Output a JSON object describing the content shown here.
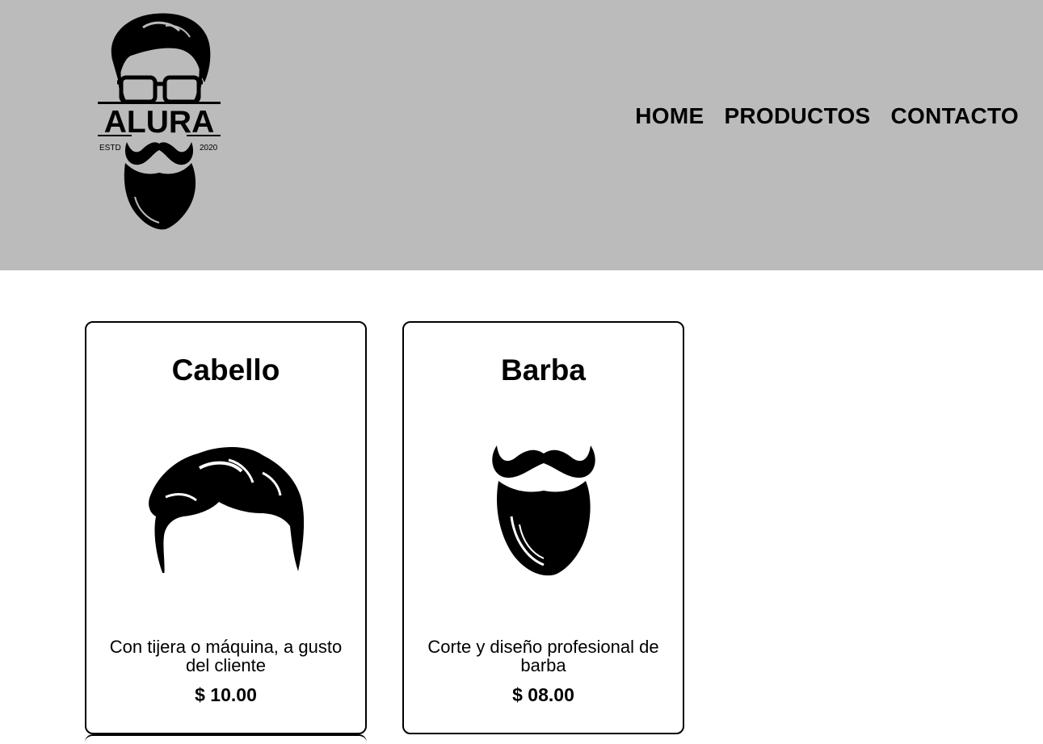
{
  "header": {
    "logo": {
      "brand": "ALURA",
      "est_left": "ESTD",
      "est_right": "2020"
    },
    "nav": [
      {
        "label": "HOME"
      },
      {
        "label": "PRODUCTOS"
      },
      {
        "label": "CONTACTO"
      }
    ],
    "background": "#bbbbbb"
  },
  "products": [
    {
      "title": "Cabello",
      "image": "hair-icon",
      "description": "Con tijera o máquina, a gusto del cliente",
      "price": "$ 10.00"
    },
    {
      "title": "Barba",
      "image": "beard-icon",
      "description": "Corte y diseño profesional de barba",
      "price": "$ 08.00"
    }
  ]
}
